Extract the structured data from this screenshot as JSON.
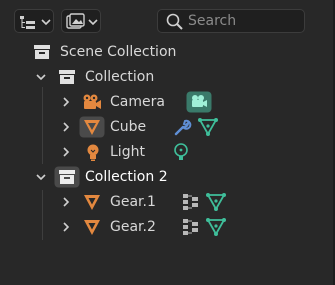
{
  "header": {
    "display_mode_icon": "outliner-tree-icon",
    "filter_icon": "filter-icon",
    "search": {
      "placeholder": "Search",
      "value": ""
    }
  },
  "outliner": {
    "scene_collection": {
      "label": "Scene Collection",
      "icon": "scene-collection-icon"
    },
    "collections": [
      {
        "label": "Collection",
        "expanded": true,
        "objects": [
          {
            "label": "Camera",
            "icon": "camera-object-icon",
            "data_icon": "camera-data-icon"
          },
          {
            "label": "Cube",
            "icon": "mesh-object-icon",
            "modifier_icon": "wrench-icon",
            "data_icon": "mesh-data-icon"
          },
          {
            "label": "Light",
            "icon": "light-object-icon",
            "data_icon": "light-data-icon"
          }
        ]
      },
      {
        "label": "Collection 2",
        "expanded": true,
        "active": true,
        "objects": [
          {
            "label": "Gear.1",
            "icon": "mesh-object-icon",
            "modifier_icon": "geometry-nodes-icon",
            "data_icon": "mesh-data-icon"
          },
          {
            "label": "Gear.2",
            "icon": "mesh-object-icon",
            "modifier_icon": "geometry-nodes-icon",
            "data_icon": "mesh-data-icon"
          }
        ]
      }
    ]
  },
  "colors": {
    "background": "#282828",
    "object_orange": "#e3883f",
    "mesh_data_green": "#3fbe9a",
    "modifier_blue": "#5f8fd6",
    "camera_data_bg": "#3a7a6a"
  }
}
